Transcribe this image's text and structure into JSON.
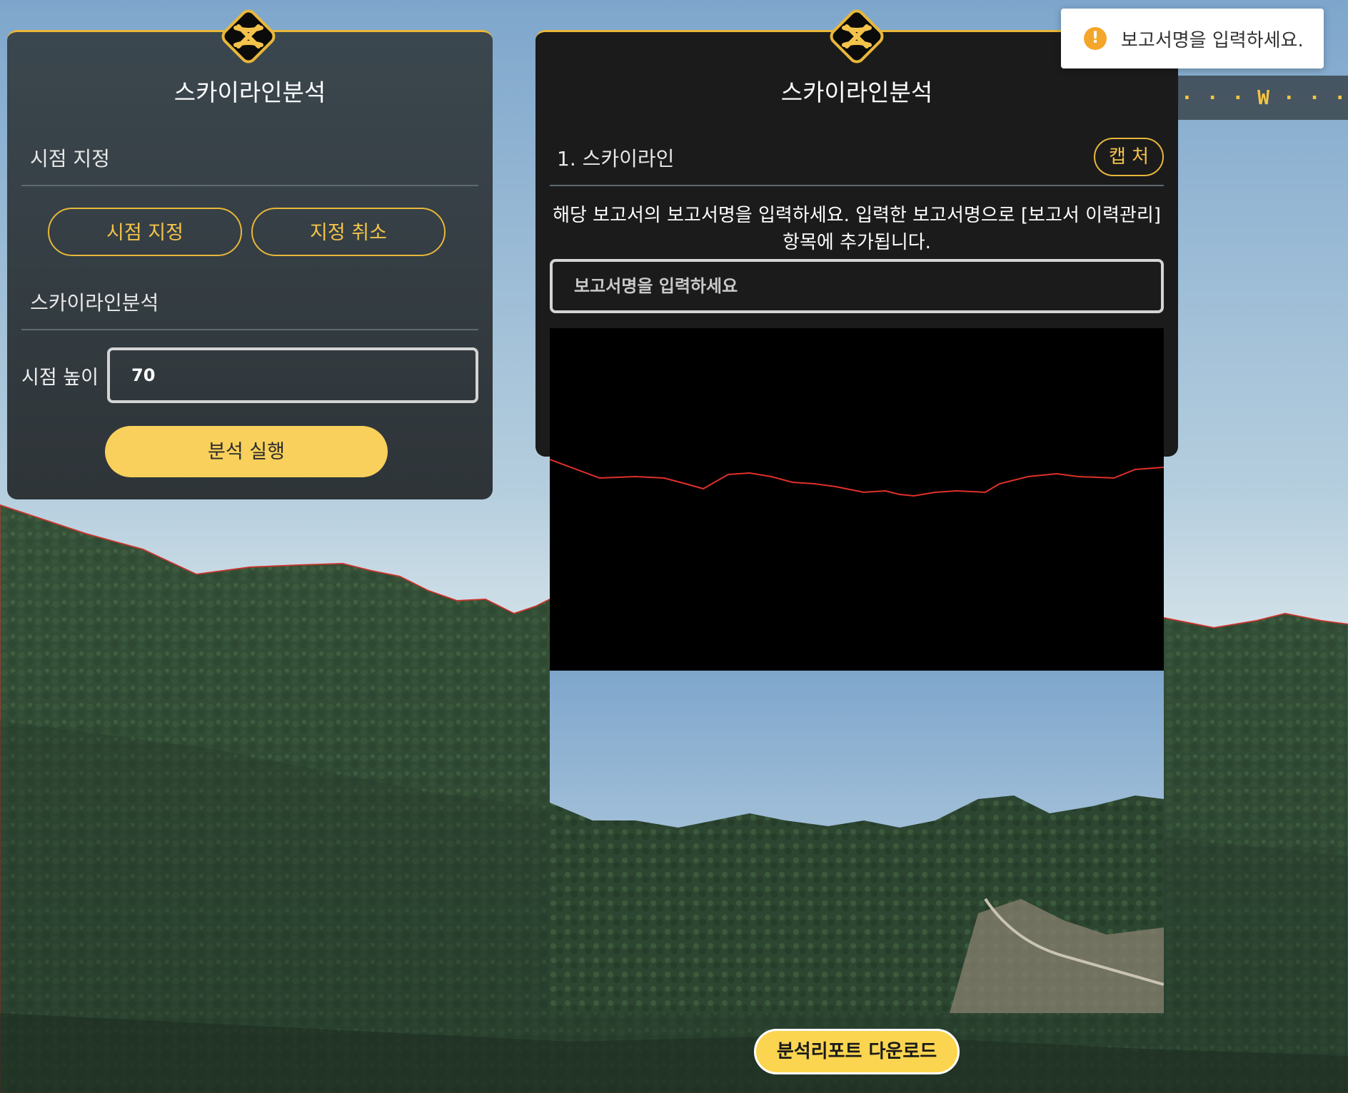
{
  "compass": {
    "label": "· · · W · · · · · · N"
  },
  "left_panel": {
    "title": "스카이라인분석",
    "viewpoint_section": "시점 지정",
    "set_viewpoint_button": "시점 지정",
    "cancel_viewpoint_button": "지정 취소",
    "analysis_section": "스카이라인분석",
    "height_label": "시점 높이",
    "height_value": "70",
    "run_button": "분석 실행",
    "close_icon": "close-icon"
  },
  "right_panel": {
    "title": "스카이라인분석",
    "section_title": "1. 스카이라인",
    "capture_button": "캡 처",
    "description": "해당 보고서의 보고서명을 입력하세요. 입력한 보고서명으로 [보고서 이력관리] 항목에 추가됩니다.",
    "report_name_value": "",
    "report_name_placeholder": "보고서명을 입력하세요",
    "close_icon": "close-icon"
  },
  "toast": {
    "message": "보고서명을 입력하세요.",
    "icon": "warning-icon"
  },
  "download_button": "분석리포트 다운로드",
  "colors": {
    "accent": "#e8b73a",
    "primary_button": "#f8d05b",
    "skyline_line": "#e0302a",
    "warning": "#f4a62a"
  }
}
